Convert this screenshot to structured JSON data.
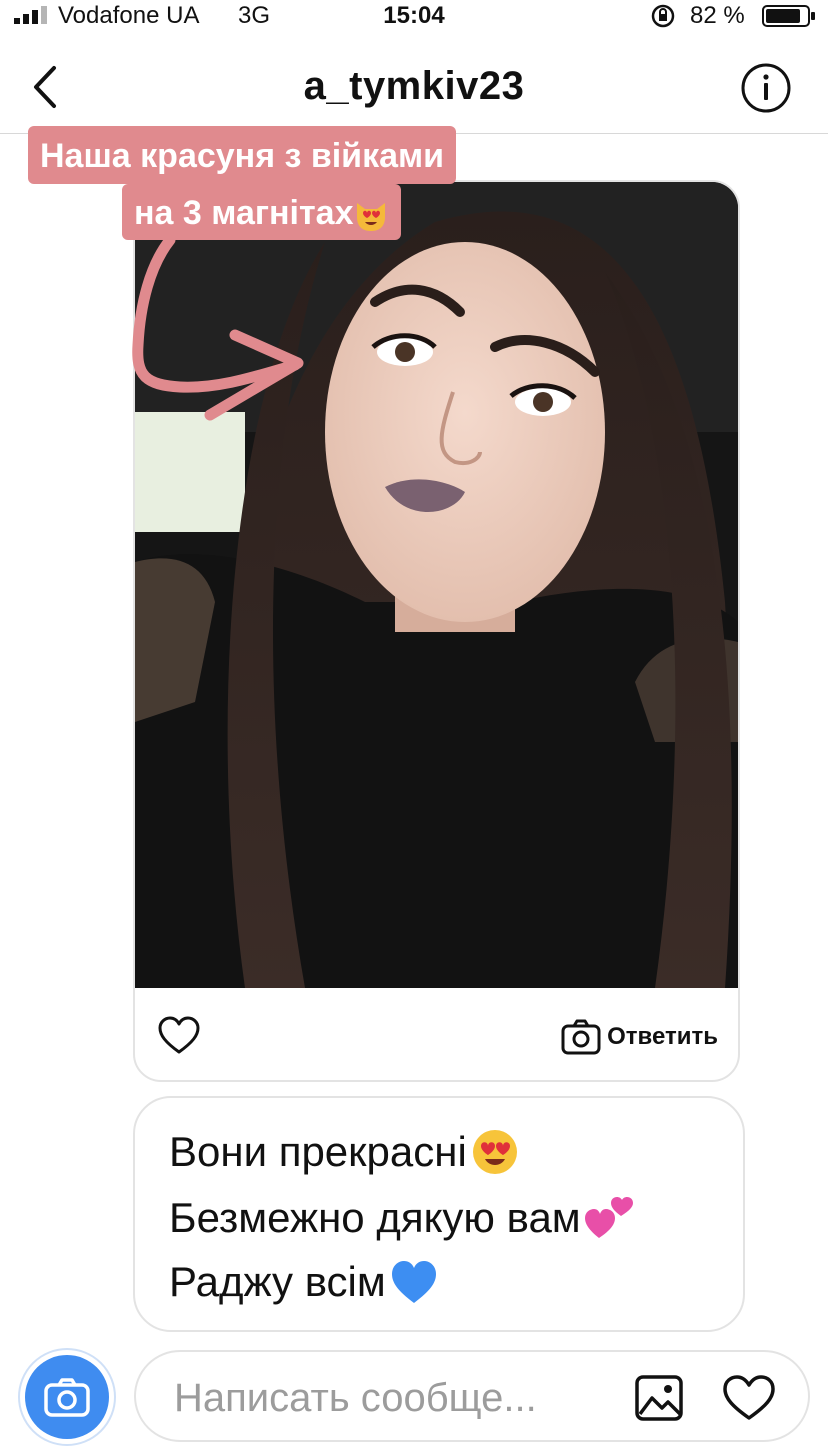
{
  "status_bar": {
    "carrier": "Vodafone UA",
    "network": "3G",
    "time": "15:04",
    "battery_percent": "82 %"
  },
  "header": {
    "title": "a_tymkiv23"
  },
  "story": {
    "caption_line1": "Наша красуня з війками",
    "caption_line2": "на 3 магнітах",
    "caption_emoji": "heart-eyes-cat-emoji",
    "reply_label": "Ответить",
    "sticker_color": "#e08a8e"
  },
  "message": {
    "line1": "Вони прекрасні",
    "line1_emoji": "heart-eyes-emoji",
    "line2": "Безмежно дякую вам",
    "line2_emoji": "two-hearts-emoji",
    "line3": "Раджу всім",
    "line3_emoji": "blue-heart-emoji"
  },
  "composer": {
    "placeholder": "Написать сообще...",
    "camera_color": "#3f8cf0"
  }
}
